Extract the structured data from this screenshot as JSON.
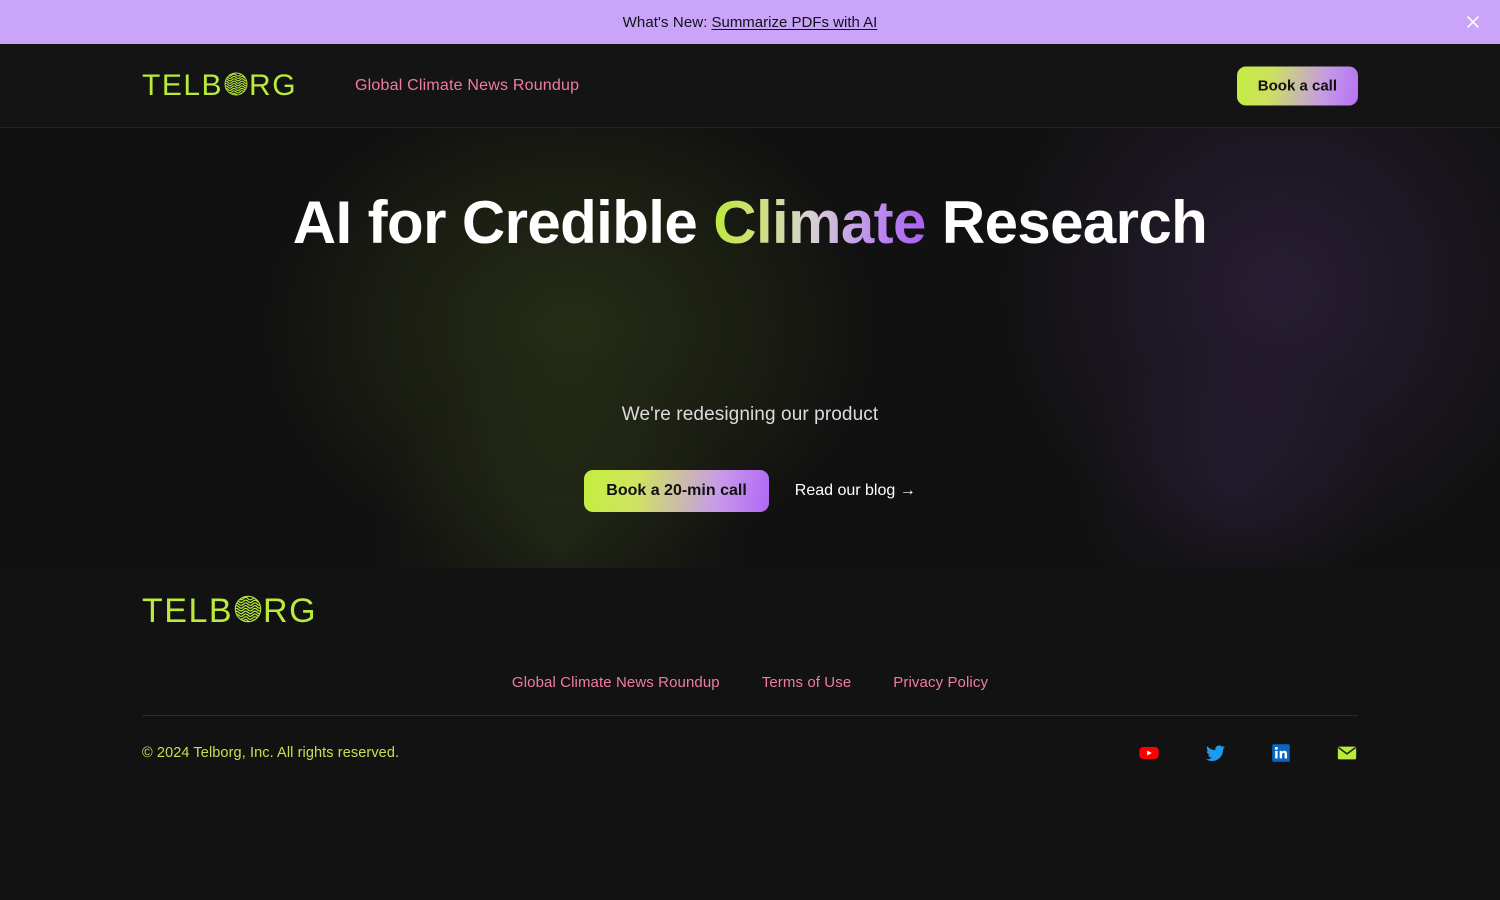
{
  "announcement": {
    "prefix": "What's New:",
    "link_label": "Summarize PDFs with AI",
    "close_icon": "close-icon"
  },
  "header": {
    "logo_before": "TELB",
    "logo_after": "RG",
    "logo_icon": "wave-circle-icon",
    "nav": [
      {
        "label": "Global Climate News Roundup"
      }
    ],
    "cta_label": "Book a call"
  },
  "hero": {
    "title_part1": "AI for Credible ",
    "title_highlight": "Climate",
    "title_part2": " Research",
    "subtitle": "We're redesigning our product",
    "primary_cta": "Book a 20-min call",
    "secondary_cta": "Read our blog →"
  },
  "footer": {
    "logo_before": "TELB",
    "logo_after": "RG",
    "logo_icon": "wave-circle-icon",
    "links": [
      {
        "label": "Global Climate News Roundup"
      },
      {
        "label": "Terms of Use"
      },
      {
        "label": "Privacy Policy"
      }
    ],
    "copyright": "© 2024 Telborg, Inc. All rights reserved.",
    "socials": [
      {
        "name": "youtube-icon",
        "color": "#ff0000"
      },
      {
        "name": "twitter-icon",
        "color": "#1d9bf0"
      },
      {
        "name": "linkedin-icon",
        "color": "#0a66c2"
      },
      {
        "name": "email-icon",
        "color": "#b9ea3d"
      }
    ]
  },
  "colors": {
    "accent_green": "#b9ea3d",
    "accent_purple": "#b572f2",
    "accent_pink": "#f07ba5",
    "banner_bg": "#c9a4f8",
    "page_bg": "#121212"
  }
}
